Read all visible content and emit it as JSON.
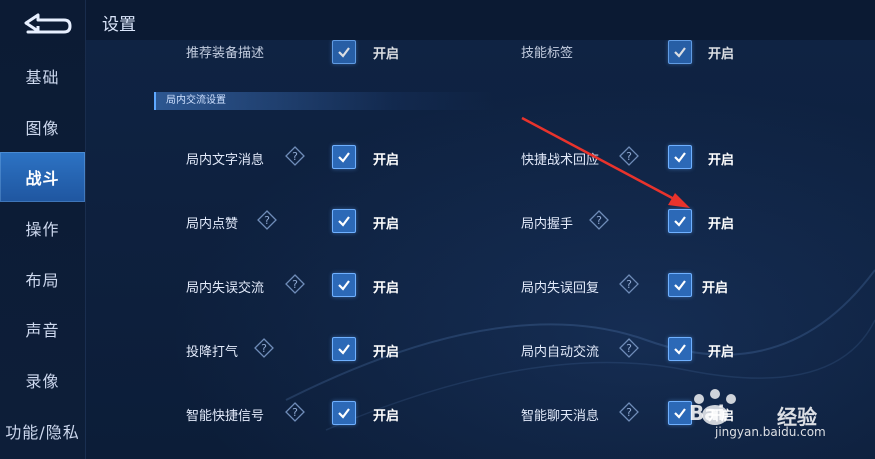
{
  "header": {
    "title": "设置"
  },
  "sidebar": {
    "items": [
      {
        "label": "基础"
      },
      {
        "label": "图像"
      },
      {
        "label": "战斗"
      },
      {
        "label": "操作"
      },
      {
        "label": "布局"
      },
      {
        "label": "声音"
      },
      {
        "label": "录像"
      },
      {
        "label": "功能/隐私"
      }
    ],
    "active_index": 2
  },
  "top_partial_row": {
    "left_label": "推荐装备描述",
    "left_value": "开启",
    "right_label": "技能标签",
    "right_value": "开启"
  },
  "section": {
    "title": "局内交流设置"
  },
  "rows": [
    {
      "left_label": "局内文字消息",
      "left_value": "开启",
      "right_label": "快捷战术回应",
      "right_value": "开启"
    },
    {
      "left_label": "局内点赞",
      "left_value": "开启",
      "right_label": "局内握手",
      "right_value": "开启"
    },
    {
      "left_label": "局内失误交流",
      "left_value": "开启",
      "right_label": "局内失误回复",
      "right_value": "开启"
    },
    {
      "left_label": "投降打气",
      "left_value": "开启",
      "right_label": "局内自动交流",
      "right_value": "开启"
    },
    {
      "left_label": "智能快捷信号",
      "left_value": "开启",
      "right_label": "智能聊天消息",
      "right_value": "开启"
    }
  ],
  "colors": {
    "accent": "#2c69b7",
    "active_tab": "#2d73c4",
    "arrow": "#e8332c",
    "background": "#0b1a33"
  },
  "icons": {
    "back": "back-arrow-icon",
    "help": "question-diamond-icon",
    "check": "checkmark-icon"
  },
  "watermark": {
    "brand": "Bai",
    "brand2": "经验",
    "url": "jingyan.baidu.com"
  }
}
